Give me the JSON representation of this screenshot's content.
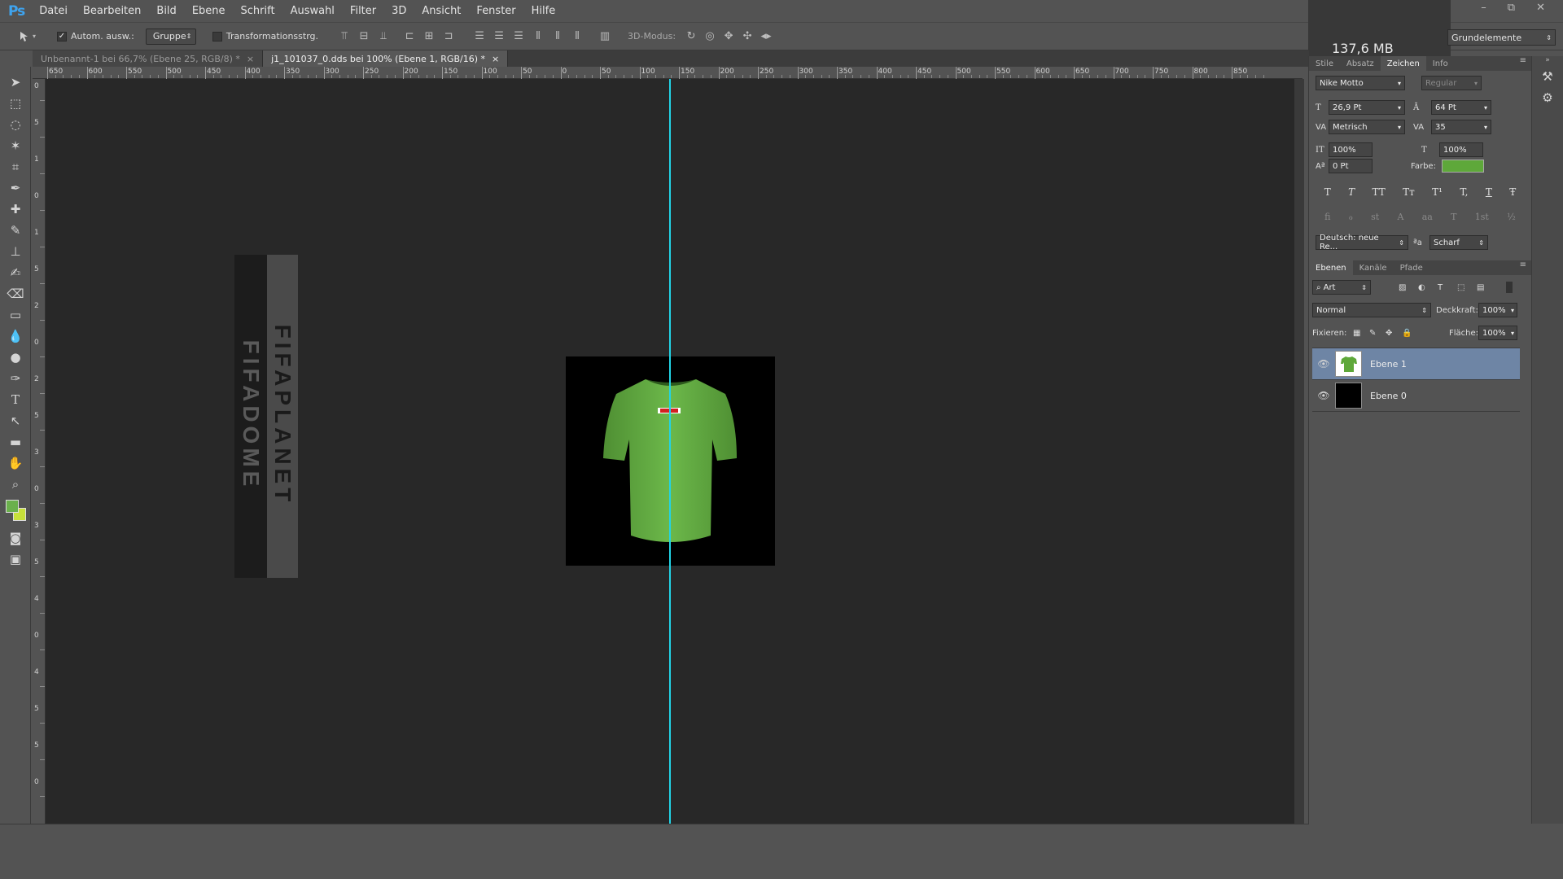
{
  "app": {
    "logo": "Ps"
  },
  "menu": [
    "Datei",
    "Bearbeiten",
    "Bild",
    "Ebene",
    "Schrift",
    "Auswahl",
    "Filter",
    "3D",
    "Ansicht",
    "Fenster",
    "Hilfe"
  ],
  "window_controls": {
    "minimize": "–",
    "restore": "⧉",
    "close": "✕"
  },
  "options": {
    "auto_select_label": "Autom. ausw.:",
    "auto_select_value": "Gruppe",
    "transform_label": "Transformationsstrg.",
    "mode3d_label": "3D-Modus:"
  },
  "memory": "137,6 MB",
  "workspace": "Grundelemente",
  "tabs": [
    {
      "label": "Unbenannt-1 bei 66,7% (Ebene 25, RGB/8) *",
      "close": "×"
    },
    {
      "label": "j1_101037_0.dds bei 100% (Ebene 1, RGB/16) *",
      "close": "×"
    }
  ],
  "ruler_top": [
    "650",
    "600",
    "550",
    "500",
    "450",
    "400",
    "350",
    "300",
    "250",
    "200",
    "150",
    "100",
    "50",
    "0",
    "50",
    "100",
    "150",
    "200",
    "250",
    "300",
    "350",
    "400",
    "450",
    "500",
    "550",
    "600",
    "650",
    "700",
    "750",
    "800",
    "850"
  ],
  "ruler_left": [
    "0",
    "5",
    "1",
    "0",
    "1",
    "5",
    "2",
    "0",
    "2",
    "5",
    "3",
    "0",
    "3",
    "5",
    "4",
    "0",
    "4",
    "5",
    "5",
    "0"
  ],
  "canvas": {
    "text_vertical_1": "FIFADOME",
    "text_vertical_2": "FIFAPLANET",
    "shirt_color": "#6ab04c",
    "guide_color": "#22d3e6"
  },
  "char_panel": {
    "tabs": [
      "Stile",
      "Absatz",
      "Zeichen",
      "Info"
    ],
    "active_tab": "Zeichen",
    "font": "Nike Motto",
    "style": "Regular",
    "size": "26,9 Pt",
    "leading": "64 Pt",
    "kerning": "Metrisch",
    "tracking": "35",
    "vscale": "100%",
    "hscale": "100%",
    "baseline": "0 Pt",
    "color_label": "Farbe:",
    "color": "#5ea83a",
    "styles_row": [
      "T",
      "T",
      "TT",
      "Tт",
      "T¹",
      "T,",
      "T",
      "Ŧ"
    ],
    "opentype_row": [
      "ﬁ",
      "ℴ",
      "st",
      "A",
      "aa",
      "T",
      "1st",
      "½"
    ],
    "language": "Deutsch: neue Re...",
    "aa_label": "ªa",
    "antialias": "Scharf"
  },
  "layers_panel": {
    "tabs": [
      "Ebenen",
      "Kanäle",
      "Pfade"
    ],
    "active_tab": "Ebenen",
    "filter": "Art",
    "blend": "Normal",
    "opacity_label": "Deckkraft:",
    "opacity": "100%",
    "lock_label": "Fixieren:",
    "fill_label": "Fläche:",
    "fill": "100%",
    "layers": [
      {
        "name": "Ebene 1",
        "selected": true
      },
      {
        "name": "Ebene 0",
        "selected": false
      }
    ]
  }
}
